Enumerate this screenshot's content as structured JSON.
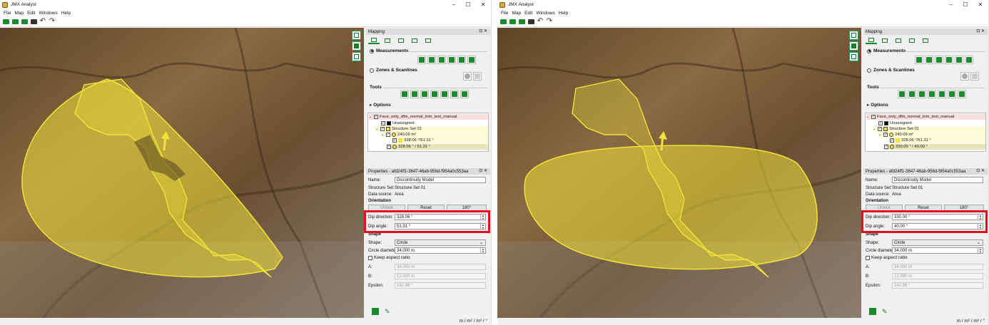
{
  "left": {
    "app_title": "JMX Analyst",
    "menus": [
      "File",
      "Map",
      "Edit",
      "Windows",
      "Help"
    ],
    "panel_title": "Mapping",
    "measurements_label": "Measurements",
    "zones_label": "Zones & Scanlines",
    "tools_label": "Tools",
    "options_label": "Options",
    "tree": {
      "root": "Face_only_dfm_normal_trim_test_manual",
      "unassigned": "Unassigned",
      "structure_set": "Structure Set 01",
      "area": "240.09 m²",
      "orientation": "328.06 °/51.31 °",
      "selected": "328.06 ° / 51.31 °"
    },
    "properties_title": "Properties - afd24ff1-3647-46ab-956d-f954a0c553aa",
    "name_label": "Name:",
    "name_value": "Discontinuity Model",
    "structure_set_label": "Structure Set:",
    "structure_set_value": "Structure Set 01",
    "data_source_label": "Data source:",
    "data_source_value": "Area",
    "orientation_label": "Orientation",
    "unlock_label": "Unlock",
    "reset_label": "Reset",
    "rotate_label": "180°",
    "dip_direction_label": "Dip direction:",
    "dip_direction_value": "328.06 °",
    "dip_angle_label": "Dip angle:",
    "dip_angle_value": "51.31 °",
    "shape_section": "Shape",
    "shape_label": "Shape:",
    "shape_value": "Circle",
    "diameter_label": "Circle diameter:",
    "diameter_value": "34.000 m",
    "aspect_label": "Keep aspect ratio",
    "a_label": "A:",
    "a_value": "34.000 m",
    "b_label": "B:",
    "b_value": "12.000 m",
    "epsilon_label": "Epsilon:",
    "epsilon_value": "142.96 °",
    "units": "m / m² / m³ / °"
  },
  "right": {
    "app_title": "JMX Analyst",
    "menus": [
      "File",
      "Map",
      "Edit",
      "Windows",
      "Help"
    ],
    "panel_title": "Mapping",
    "measurements_label": "Measurements",
    "zones_label": "Zones & Scanlines",
    "tools_label": "Tools",
    "options_label": "Options",
    "tree": {
      "root": "Face_only_dfm_normal_trim_test_manual",
      "unassigned": "Unassigned",
      "structure_set": "Structure Set 01",
      "area": "240.09 m²",
      "orientation": "328.06 °/51.31 °",
      "selected": "330.00 ° / 40.00 °"
    },
    "properties_title": "Properties - afd24ff1-3647-46ab-956d-f954a0c553aa",
    "name_label": "Name:",
    "name_value": "Discontinuity Model",
    "structure_set_label": "Structure Set:",
    "structure_set_value": "Structure Set 01",
    "data_source_label": "Data source:",
    "data_source_value": "Area",
    "orientation_label": "Orientation",
    "unlock_label": "Unlock",
    "reset_label": "Reset",
    "rotate_label": "180°",
    "dip_direction_label": "Dip direction:",
    "dip_direction_value": "330.00 °",
    "dip_angle_label": "Dip angle:",
    "dip_angle_value": "40.00 °",
    "shape_section": "Shape",
    "shape_label": "Shape:",
    "shape_value": "Circle",
    "diameter_label": "Circle diameter:",
    "diameter_value": "34.000 m",
    "aspect_label": "Keep aspect ratio",
    "a_label": "A:",
    "a_value": "34.000 m",
    "b_label": "B:",
    "b_value": "12.000 m",
    "epsilon_label": "Epsilon:",
    "epsilon_value": "142.96 °",
    "units": "m / m² / m³ / °"
  },
  "colors": {
    "accent_green": "#1a8a2a",
    "highlight_red": "#e01020",
    "overlay_yellow": "#f2e23a",
    "rock_brown": "#7a5a36"
  }
}
